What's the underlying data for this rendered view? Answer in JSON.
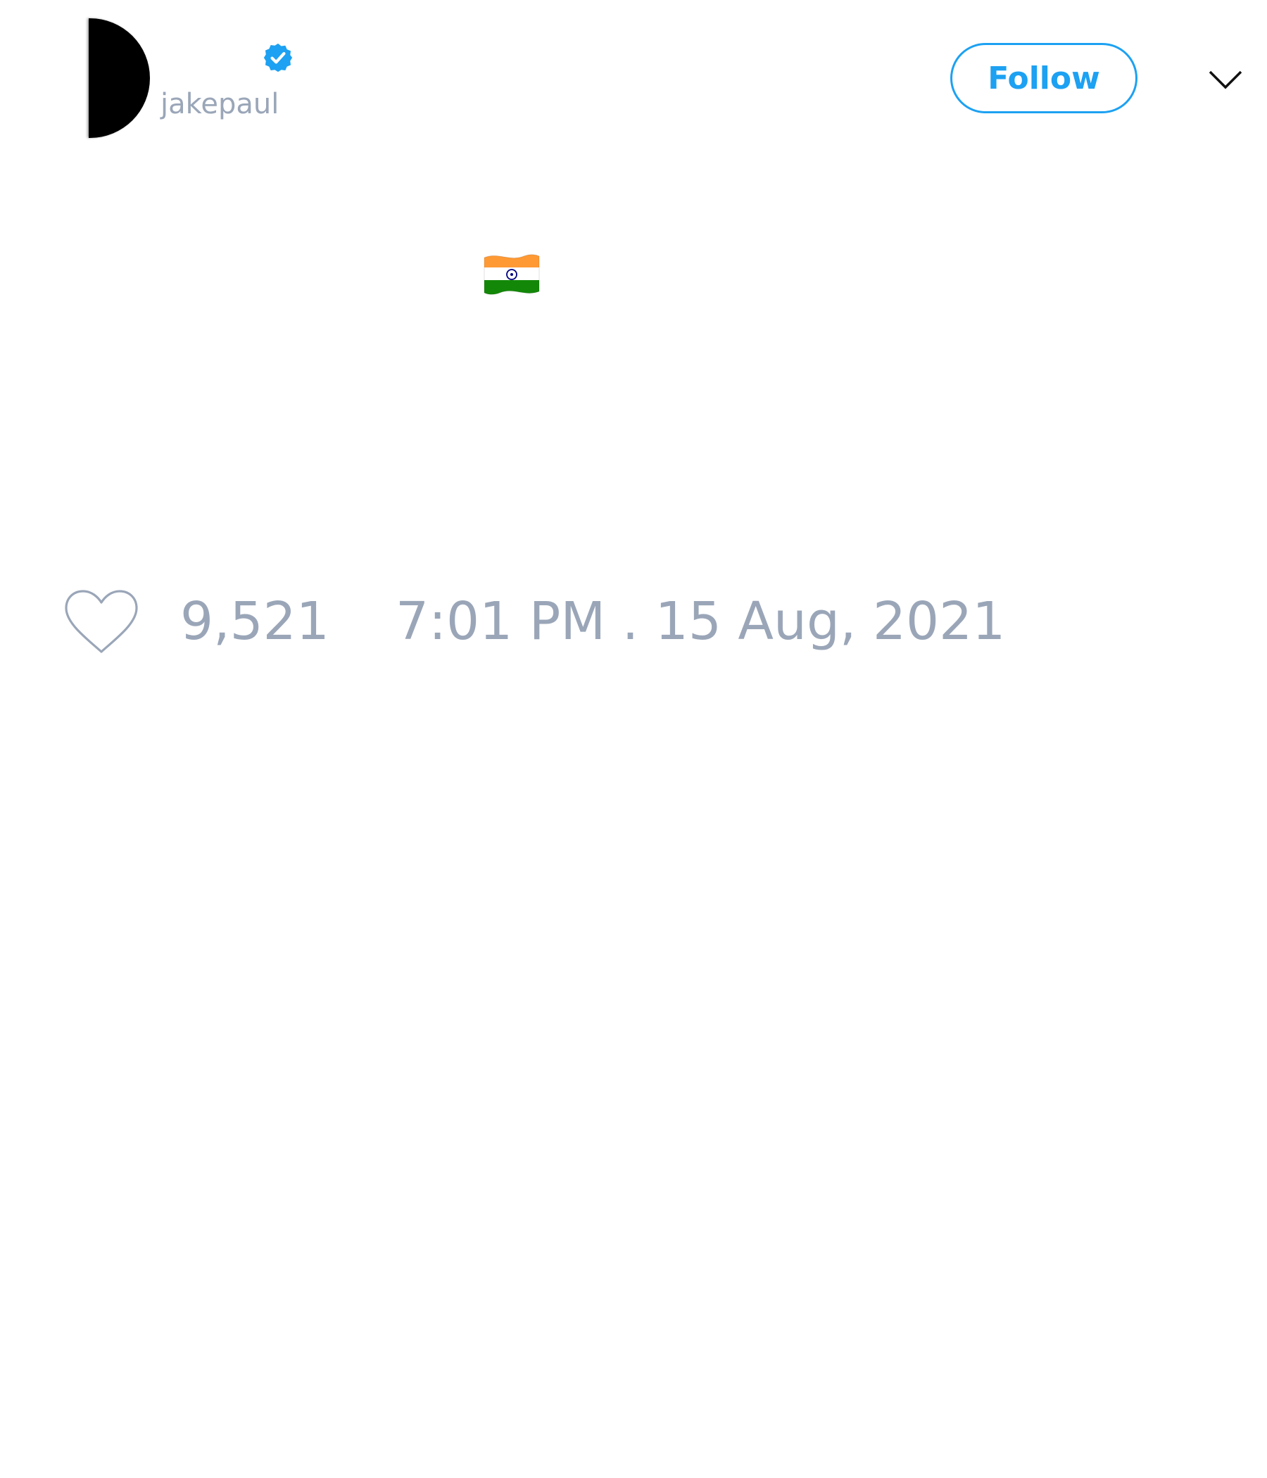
{
  "tweet": {
    "author": {
      "handle": "jakepaul",
      "verified": true,
      "verified_icon": "verified-badge-icon"
    },
    "follow_label": "Follow",
    "menu_icon": "chevron-down-icon",
    "body": {
      "emoji": "flag-india-icon"
    },
    "likes": {
      "icon": "heart-icon",
      "count": "9,521"
    },
    "timestamp": "7:01 PM . 15 Aug, 2021"
  },
  "colors": {
    "accent": "#1da1f2",
    "muted_text": "#9aa6b8",
    "background": "#ffffff"
  }
}
